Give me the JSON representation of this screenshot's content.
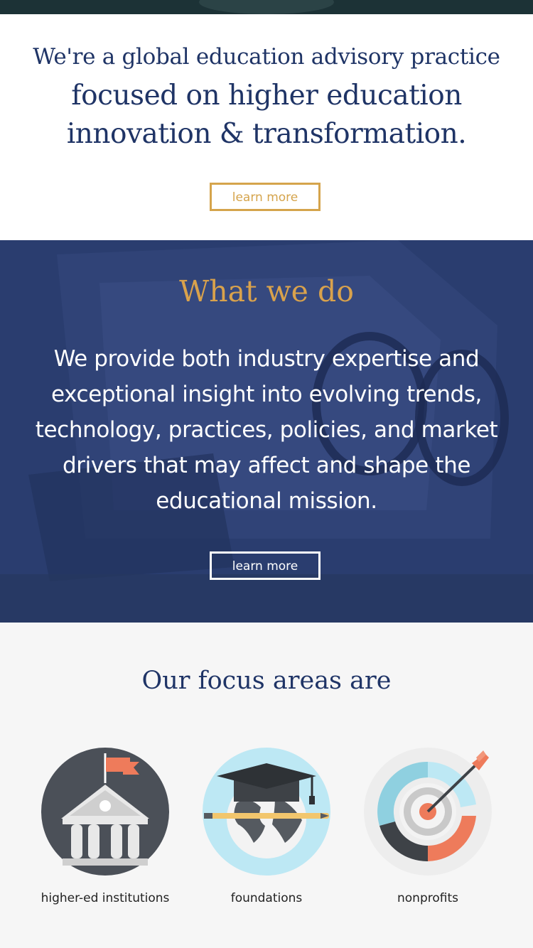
{
  "intro": {
    "line1": "We're a global education advisory practice",
    "line2": "focused on higher education innovation & transformation.",
    "button_label": "learn more"
  },
  "what_we_do": {
    "title": "What we do",
    "body": "We provide both industry expertise and exceptional insight into evolving trends, technology, practices, policies, and market drivers that may affect and shape the educational mission.",
    "button_label": "learn more"
  },
  "focus": {
    "title": "Our focus areas are",
    "items": [
      {
        "label": "higher-ed institutions",
        "icon": "university-building-icon"
      },
      {
        "label": "foundations",
        "icon": "graduation-globe-icon"
      },
      {
        "label": "nonprofits",
        "icon": "target-arrow-icon"
      }
    ]
  },
  "colors": {
    "navy": "#1f3466",
    "gold": "#d5a44c",
    "section_blue": "#2a3d6f",
    "coral": "#ee7b5b",
    "light_blue": "#bde8f4"
  }
}
